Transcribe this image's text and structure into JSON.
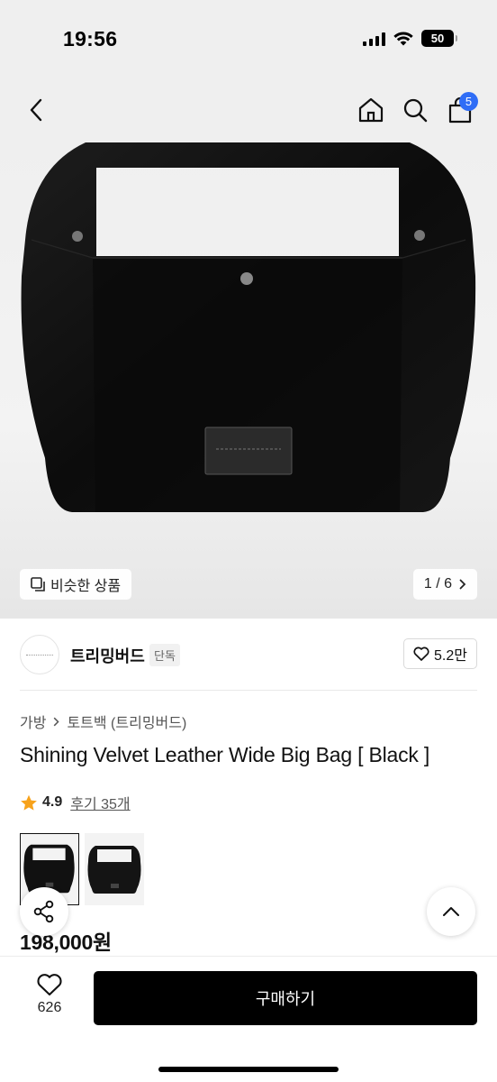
{
  "status_bar": {
    "time": "19:56",
    "battery": "50",
    "battery_level": 0.5
  },
  "header": {
    "back_icon": "chevron-left-icon",
    "home_icon": "home-icon",
    "search_icon": "search-icon",
    "cart_icon": "shopping-bag-icon",
    "cart_count": "5",
    "badge_color": "#2f6df6"
  },
  "gallery": {
    "similar_label": "비슷한 상품",
    "page_indicator": "1 / 6"
  },
  "brand": {
    "name": "트리밍버드",
    "tag": "단독",
    "likes": "5.2만"
  },
  "breadcrumb": {
    "category": "가방",
    "subcategory": "토트백 (트리밍버드)"
  },
  "product": {
    "title": "Shining Velvet Leather Wide Big Bag [ Black ]",
    "rating": "4.9",
    "reviews": "후기 35개",
    "price": "198,000원"
  },
  "bottom_bar": {
    "like_count": "626",
    "buy_label": "구매하기"
  }
}
